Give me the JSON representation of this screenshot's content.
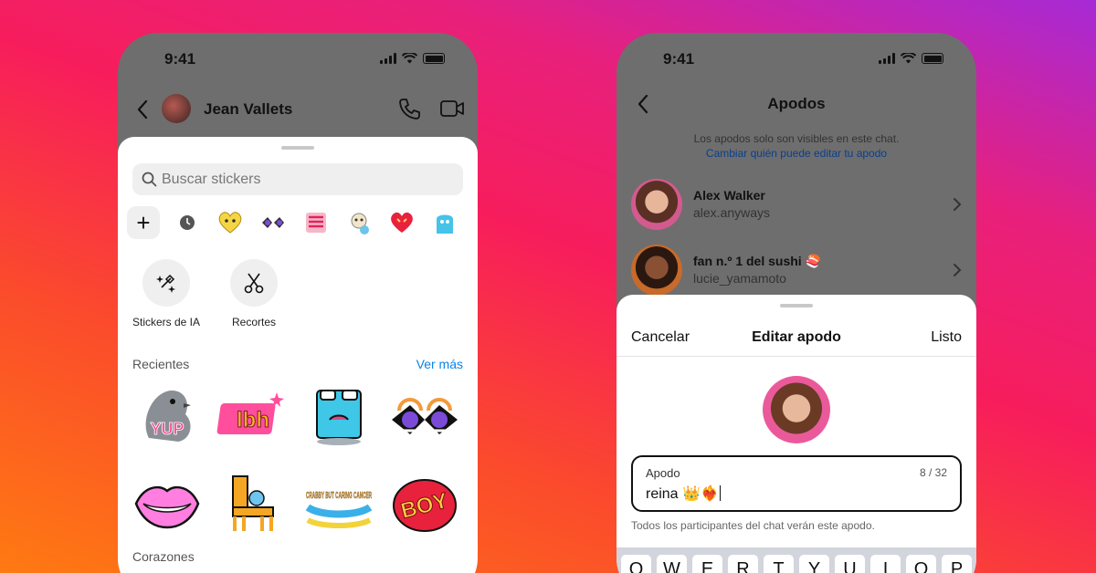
{
  "left_phone": {
    "status_time": "9:41",
    "contact_name": "Jean Vallets",
    "search_placeholder": "Buscar stickers",
    "tools": [
      {
        "label": "Stickers de IA",
        "icon": "ai-sparkle-icon"
      },
      {
        "label": "Recortes",
        "icon": "scissors-icon"
      }
    ],
    "recent_title": "Recientes",
    "see_more": "Ver más",
    "stickers": [
      {
        "name": "sticker-yup-pigeon",
        "text": "YUP"
      },
      {
        "name": "sticker-lbh",
        "text": "lbh"
      },
      {
        "name": "sticker-melting-face",
        "text": ""
      },
      {
        "name": "sticker-eyes",
        "text": ""
      },
      {
        "name": "sticker-lips",
        "text": ""
      },
      {
        "name": "sticker-chair",
        "text": ""
      },
      {
        "name": "sticker-crabby",
        "text": "CRABBY BUT CARING CANCER"
      },
      {
        "name": "sticker-boy",
        "text": "BOY"
      }
    ],
    "hearts_title": "Corazones"
  },
  "right_phone": {
    "status_time": "9:41",
    "title": "Apodos",
    "note": "Los apodos solo son visibles en este chat.",
    "note_link": "Cambiar quién puede editar tu apodo",
    "contacts": [
      {
        "name": "Alex Walker",
        "username": "alex.anyways"
      },
      {
        "name": "fan n.º 1 del sushi 🍣",
        "username": "lucie_yamamoto"
      }
    ],
    "sheet": {
      "cancel": "Cancelar",
      "title": "Editar apodo",
      "done": "Listo",
      "field_label": "Apodo",
      "field_count": "8 / 32",
      "field_value": "reina 👑❤️‍🔥",
      "hint": "Todos los participantes del chat verán este apodo."
    },
    "keyboard_row": [
      "Q",
      "W",
      "E",
      "R",
      "T",
      "Y",
      "U",
      "I",
      "O",
      "P"
    ]
  },
  "colors": {
    "link_blue": "#0a84e8",
    "accent_pink": "#e8207c",
    "accent_orange": "#ff7a12"
  }
}
